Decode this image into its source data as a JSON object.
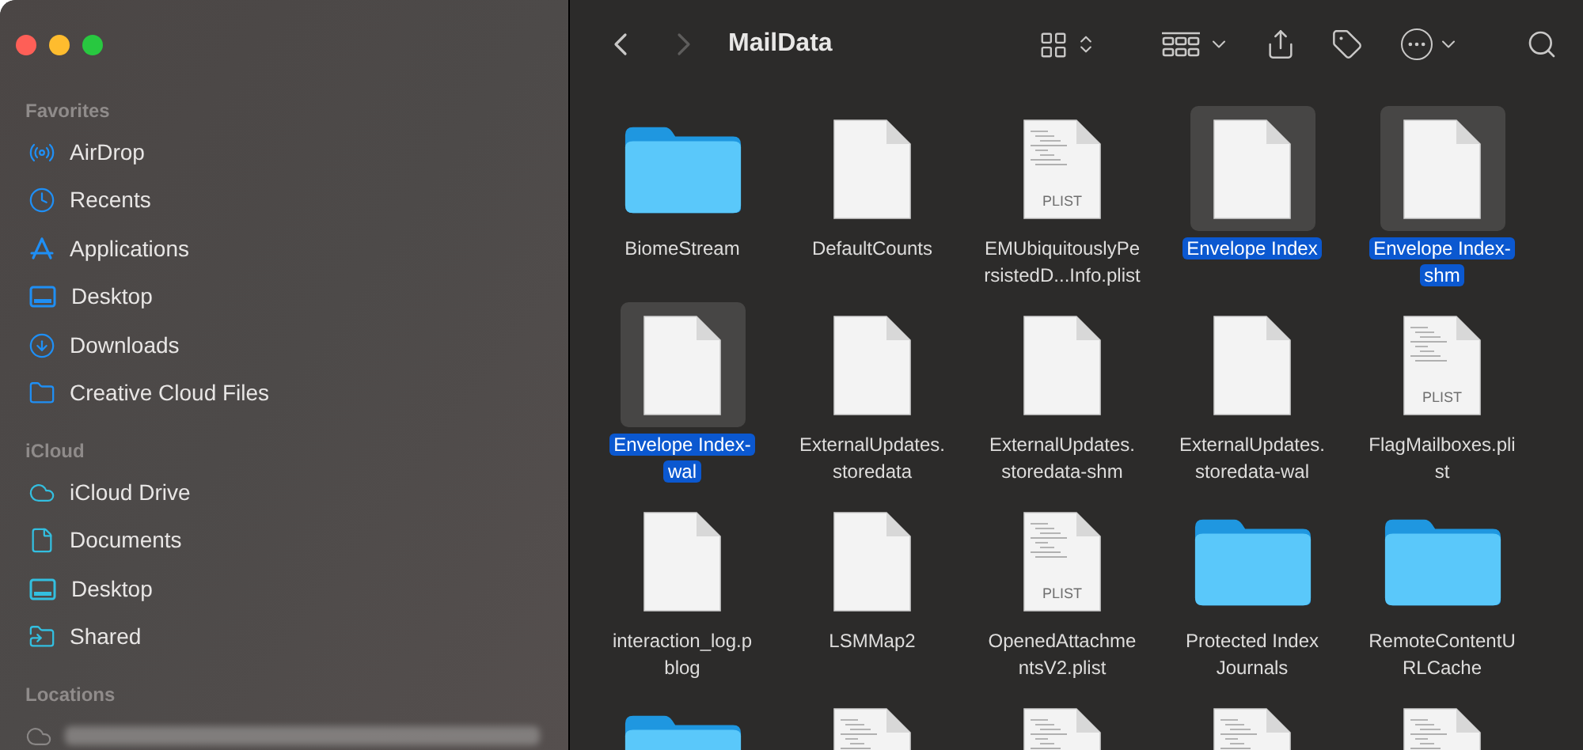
{
  "window": {
    "title": "MailData"
  },
  "sidebar": {
    "sections": [
      {
        "title": "Favorites",
        "items": [
          {
            "label": "AirDrop",
            "kind": "airdrop"
          },
          {
            "label": "Recents",
            "kind": "clock"
          },
          {
            "label": "Applications",
            "kind": "apps"
          },
          {
            "label": "Desktop",
            "kind": "desktop"
          },
          {
            "label": "Downloads",
            "kind": "download"
          },
          {
            "label": "Creative Cloud Files",
            "kind": "folder"
          }
        ]
      },
      {
        "title": "iCloud",
        "items": [
          {
            "label": "iCloud Drive",
            "kind": "cloud"
          },
          {
            "label": "Documents",
            "kind": "document"
          },
          {
            "label": "Desktop",
            "kind": "desktop"
          },
          {
            "label": "Shared",
            "kind": "shared"
          }
        ]
      },
      {
        "title": "Locations",
        "items": [
          {
            "kind": "redacted"
          }
        ]
      }
    ]
  },
  "toolbar": {
    "back": {
      "disabled": false
    },
    "forward": {
      "disabled": true
    }
  },
  "files": [
    {
      "kind": "folder",
      "lines": [
        "BiomeStream"
      ],
      "selected": false
    },
    {
      "kind": "blank",
      "lines": [
        "DefaultCounts"
      ],
      "selected": false
    },
    {
      "kind": "plist",
      "badge": "PLIST",
      "lines": [
        "EMUbiquitouslyPe",
        "rsistedD...Info.plist"
      ],
      "selected": false
    },
    {
      "kind": "blank",
      "lines": [
        "Envelope Index"
      ],
      "selected": true
    },
    {
      "kind": "blank",
      "lines": [
        "Envelope Index-",
        "shm"
      ],
      "selected": true
    },
    {
      "kind": "blank",
      "lines": [
        "Envelope Index-",
        "wal"
      ],
      "selected": true
    },
    {
      "kind": "blank",
      "lines": [
        "ExternalUpdates.",
        "storedata"
      ],
      "selected": false
    },
    {
      "kind": "blank",
      "lines": [
        "ExternalUpdates.",
        "storedata-shm"
      ],
      "selected": false
    },
    {
      "kind": "blank",
      "lines": [
        "ExternalUpdates.",
        "storedata-wal"
      ],
      "selected": false
    },
    {
      "kind": "plist",
      "badge": "PLIST",
      "lines": [
        "FlagMailboxes.pli",
        "st"
      ],
      "selected": false
    },
    {
      "kind": "blank",
      "lines": [
        "interaction_log.p",
        "blog"
      ],
      "selected": false
    },
    {
      "kind": "blank",
      "lines": [
        "LSMMap2"
      ],
      "selected": false
    },
    {
      "kind": "plist",
      "badge": "PLIST",
      "lines": [
        "OpenedAttachme",
        "ntsV2.plist"
      ],
      "selected": false
    },
    {
      "kind": "folder",
      "lines": [
        "Protected Index",
        "Journals"
      ],
      "selected": false
    },
    {
      "kind": "folder",
      "lines": [
        "RemoteContentU",
        "RLCache"
      ],
      "selected": false
    },
    {
      "kind": "folder",
      "selected": false
    },
    {
      "kind": "plist",
      "selected": false
    },
    {
      "kind": "plist",
      "selected": false
    },
    {
      "kind": "plist",
      "selected": false
    },
    {
      "kind": "plist",
      "selected": false
    }
  ]
}
